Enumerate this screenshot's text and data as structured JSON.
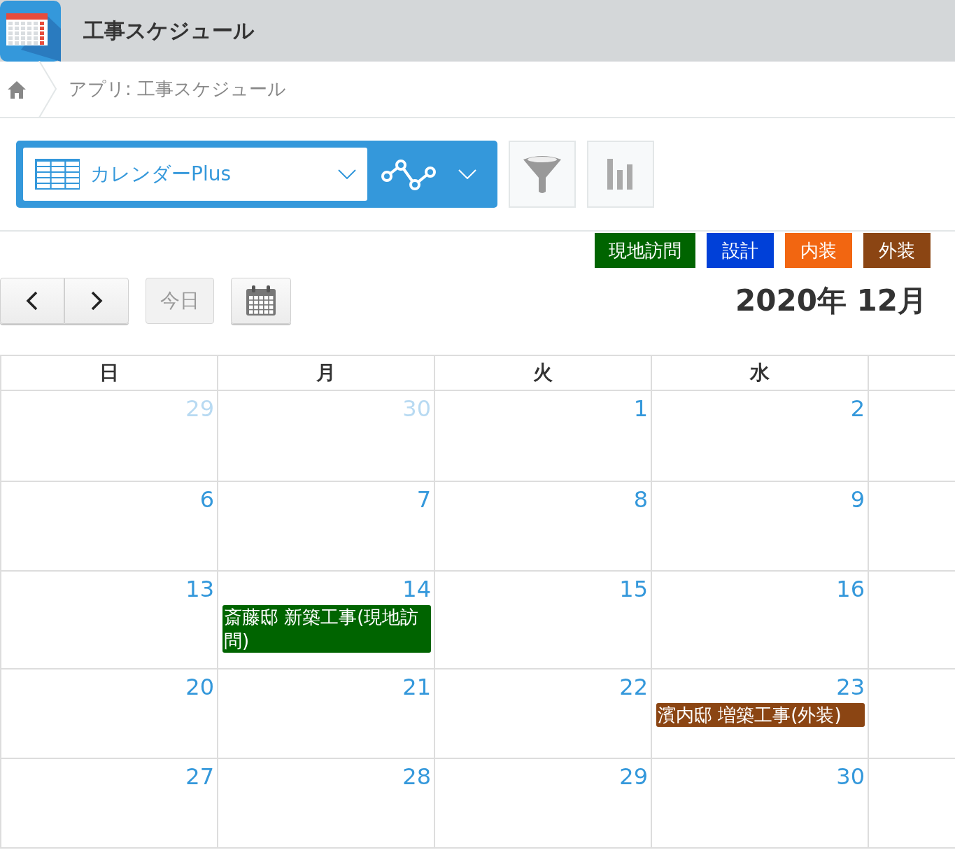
{
  "app_header": {
    "title": "工事スケジュール"
  },
  "breadcrumb": {
    "path": "アプリ: 工事スケジュール"
  },
  "view_selector": {
    "label": "カレンダーPlus"
  },
  "legend": [
    {
      "label": "現地訪問",
      "color": "#006400"
    },
    {
      "label": "設計",
      "color": "#0040d8"
    },
    {
      "label": "内装",
      "color": "#f26611"
    },
    {
      "label": "外装",
      "color": "#8b4513"
    }
  ],
  "nav": {
    "today_button": "今日"
  },
  "calendar": {
    "title": "2020年 12月",
    "weekdays": [
      "日",
      "月",
      "火",
      "水"
    ],
    "weeks": [
      [
        {
          "day": "29",
          "muted": true
        },
        {
          "day": "30",
          "muted": true
        },
        {
          "day": "1",
          "muted": false
        },
        {
          "day": "2",
          "muted": false
        }
      ],
      [
        {
          "day": "6",
          "muted": false
        },
        {
          "day": "7",
          "muted": false
        },
        {
          "day": "8",
          "muted": false
        },
        {
          "day": "9",
          "muted": false
        }
      ],
      [
        {
          "day": "13",
          "muted": false
        },
        {
          "day": "14",
          "muted": false,
          "events": [
            {
              "title": "斎藤邸 新築工事(現地訪問)",
              "color": "#006400"
            }
          ]
        },
        {
          "day": "15",
          "muted": false
        },
        {
          "day": "16",
          "muted": false
        }
      ],
      [
        {
          "day": "20",
          "muted": false
        },
        {
          "day": "21",
          "muted": false
        },
        {
          "day": "22",
          "muted": false
        },
        {
          "day": "23",
          "muted": false,
          "events": [
            {
              "title": "濱内邸 増築工事(外装)",
              "color": "#8b4513"
            }
          ]
        }
      ],
      [
        {
          "day": "27",
          "muted": false
        },
        {
          "day": "28",
          "muted": false
        },
        {
          "day": "29",
          "muted": false
        },
        {
          "day": "30",
          "muted": false
        }
      ]
    ]
  }
}
